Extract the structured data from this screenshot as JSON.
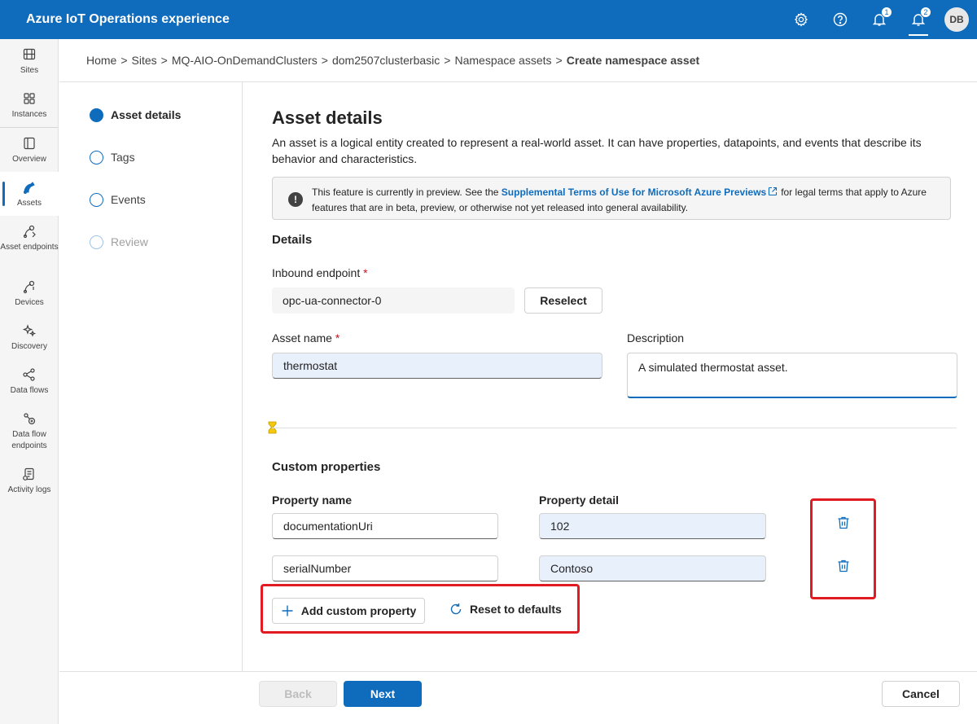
{
  "header": {
    "app_title": "Azure IoT Operations experience",
    "settings_icon": "gear-icon",
    "help_icon": "help-icon",
    "alerts_icon": "alert-icon",
    "alerts_count": "1",
    "notifications_icon": "bell-icon",
    "notifications_count": "2",
    "avatar_initials": "DB"
  },
  "rail": {
    "items": [
      {
        "label": "Sites",
        "icon": "sites-icon"
      },
      {
        "label": "Instances",
        "icon": "instances-icon"
      },
      {
        "label": "Overview",
        "icon": "overview-icon"
      },
      {
        "label": "Assets",
        "icon": "assets-icon",
        "active": true
      },
      {
        "label": "Asset endpoints",
        "icon": "asset-endpoints-icon"
      },
      {
        "label": "Devices",
        "icon": "devices-icon"
      },
      {
        "label": "Discovery",
        "icon": "discovery-icon"
      },
      {
        "label": "Data flows",
        "icon": "data-flows-icon"
      },
      {
        "label": "Data flow endpoints",
        "icon": "data-flow-endpoints-icon"
      },
      {
        "label": "Activity logs",
        "icon": "activity-logs-icon"
      }
    ]
  },
  "breadcrumb": {
    "items": [
      "Home",
      "Sites",
      "MQ-AIO-OnDemandClusters",
      "dom2507clusterbasic",
      "Namespace assets"
    ],
    "separator": ">",
    "current": "Create namespace asset"
  },
  "steps": [
    {
      "label": "Asset details",
      "state": "current"
    },
    {
      "label": "Tags",
      "state": "pending"
    },
    {
      "label": "Events",
      "state": "pending"
    },
    {
      "label": "Review",
      "state": "disabled"
    }
  ],
  "main": {
    "title": "Asset details",
    "description": "An asset is a logical entity created to represent a real-world asset. It can have properties, datapoints, and events that describe its behavior and characteristics.",
    "preview": {
      "icon": "warning-icon",
      "text_before": "This feature is currently in preview. See the",
      "link_text": "Supplemental Terms of Use for Microsoft Azure Previews",
      "text_after": "for legal terms that apply to Azure features that are in beta, preview, or otherwise not yet released into general availability."
    },
    "details": {
      "section_title": "Details",
      "inbound_endpoint_label": "Inbound endpoint",
      "inbound_endpoint_value": "opc-ua-connector-0",
      "reselect_label": "Reselect",
      "asset_name_label": "Asset name",
      "asset_name_value": "thermostat",
      "description_label": "Description",
      "description_value": "A simulated thermostat asset.",
      "required_marker": "*"
    },
    "custom_properties": {
      "section_title": "Custom properties",
      "col_name": "Property name",
      "col_detail": "Property detail",
      "rows": [
        {
          "name": "documentationUri",
          "detail": "102"
        },
        {
          "name": "serialNumber",
          "detail": "Contoso"
        }
      ],
      "add_label": "Add custom property",
      "reset_label": "Reset to defaults"
    }
  },
  "footer": {
    "back_label": "Back",
    "next_label": "Next",
    "cancel_label": "Cancel"
  }
}
